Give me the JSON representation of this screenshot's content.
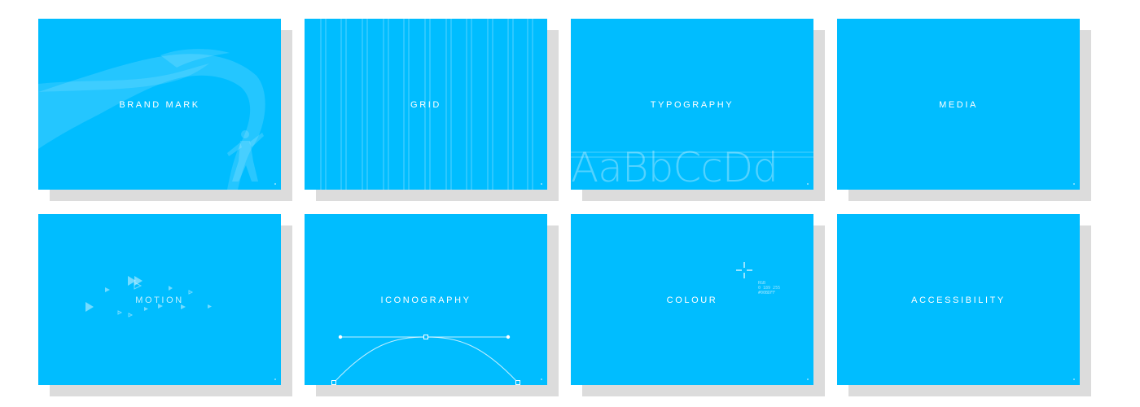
{
  "tiles": {
    "brand_mark": "BRAND MARK",
    "grid": "GRID",
    "typography": "TYPOGRAPHY",
    "media": "MEDIA",
    "motion": "MOTION",
    "iconography": "ICONOGRAPHY",
    "colour": "COLOUR",
    "accessibility": "ACCESSIBILITY"
  },
  "typography_specimen": "AaBbCcDd",
  "colour_note": [
    "RGB",
    "0 189 255",
    "#00BDFF"
  ],
  "colors": {
    "tile_background": "#00bdff",
    "shadow": "#dcdcdc",
    "label": "#ffffff"
  }
}
